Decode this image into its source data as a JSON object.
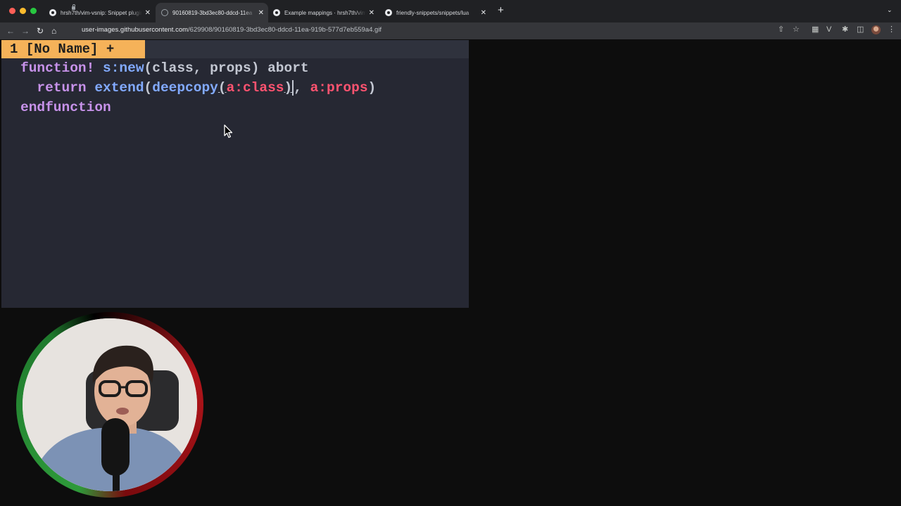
{
  "browser": {
    "tabs": [
      {
        "title": "hrsh7th/vim-vsnip: Snippet plugin",
        "icon": "github-icon",
        "active": false
      },
      {
        "title": "90160819-3bd3ec80-ddcd-11ea",
        "icon": "globe-icon",
        "active": true
      },
      {
        "title": "Example mappings · hrsh7th/vim-vsnip",
        "icon": "github-icon",
        "active": false
      },
      {
        "title": "friendly-snippets/snippets/lua",
        "icon": "github-icon",
        "active": false
      }
    ],
    "new_tab_label": "+",
    "close_glyph": "✕",
    "url_host": "user-images.githubusercontent.com",
    "url_path": "/629908/90160819-3bd3ec80-ddcd-11ea-919b-577d7eb559a4.gif"
  },
  "vim": {
    "tabline": "1 [No Name] +",
    "code": {
      "line1": {
        "kw": "function!",
        "fn": "s:new",
        "open": "(",
        "p1": "class",
        "sep": ", ",
        "p2": "props",
        "close": ")",
        "tail": "abort"
      },
      "line2": {
        "kw": "return",
        "fn1": "extend",
        "open1": "(",
        "fn2": "deepcopy",
        "open2": "(",
        "v1": "a:class",
        "close2": ")",
        "sep": ",",
        "v2": "a:props",
        "close1": ")"
      },
      "line3": {
        "kw": "endfunction"
      }
    }
  },
  "colors": {
    "editor_bg": "#262833",
    "tabline_active_bg": "#f5b259",
    "keyword": "#c792ea",
    "function": "#82aaff",
    "variable": "#ff5370"
  }
}
